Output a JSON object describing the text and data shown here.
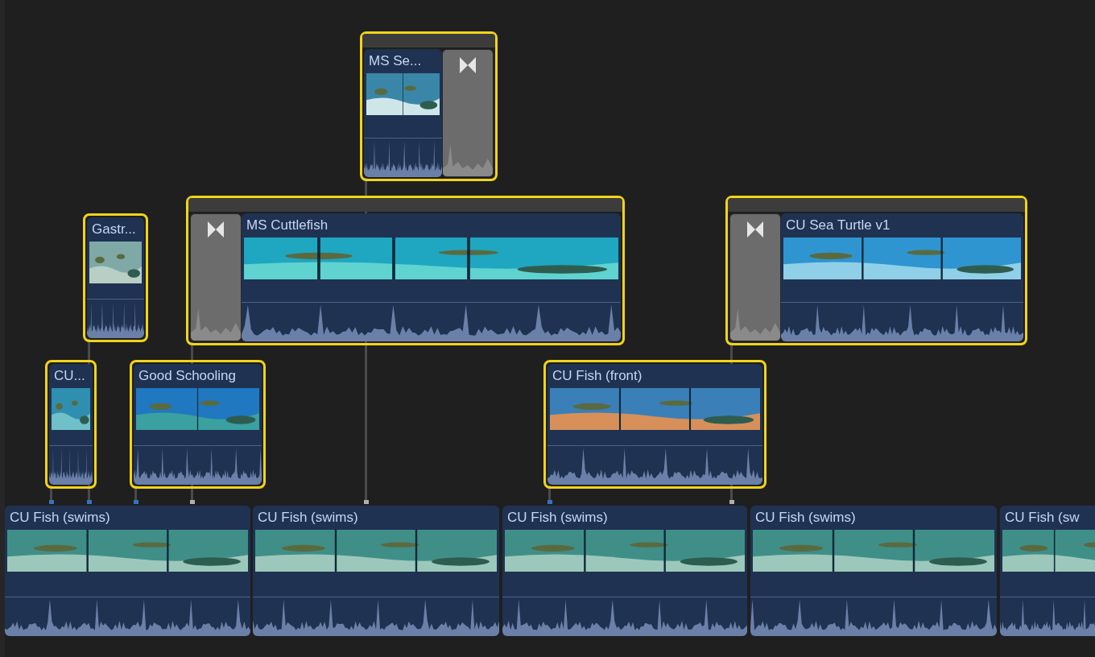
{
  "connected_clips": [
    {
      "title": "MS Se...",
      "selected": true,
      "kind": "transition_right"
    },
    {
      "title": "Gastr...",
      "selected": true,
      "kind": "plain"
    },
    {
      "title": "MS Cuttlefish",
      "selected": true,
      "kind": "transition_left"
    },
    {
      "title": "CU Sea Turtle v1",
      "selected": true,
      "kind": "transition_left"
    },
    {
      "title": "CU...",
      "selected": true,
      "kind": "plain"
    },
    {
      "title": "Good Schooling",
      "selected": true,
      "kind": "plain"
    },
    {
      "title": "CU Fish (front)",
      "selected": true,
      "kind": "plain"
    }
  ],
  "primary_storyline": [
    {
      "title": "CU Fish (swims)",
      "selected": false
    },
    {
      "title": "CU Fish (swims)",
      "selected": false
    },
    {
      "title": "CU Fish (swims)",
      "selected": false
    },
    {
      "title": "CU Fish (swims)",
      "selected": false
    },
    {
      "title": "CU Fish (sw",
      "selected": false
    }
  ]
}
